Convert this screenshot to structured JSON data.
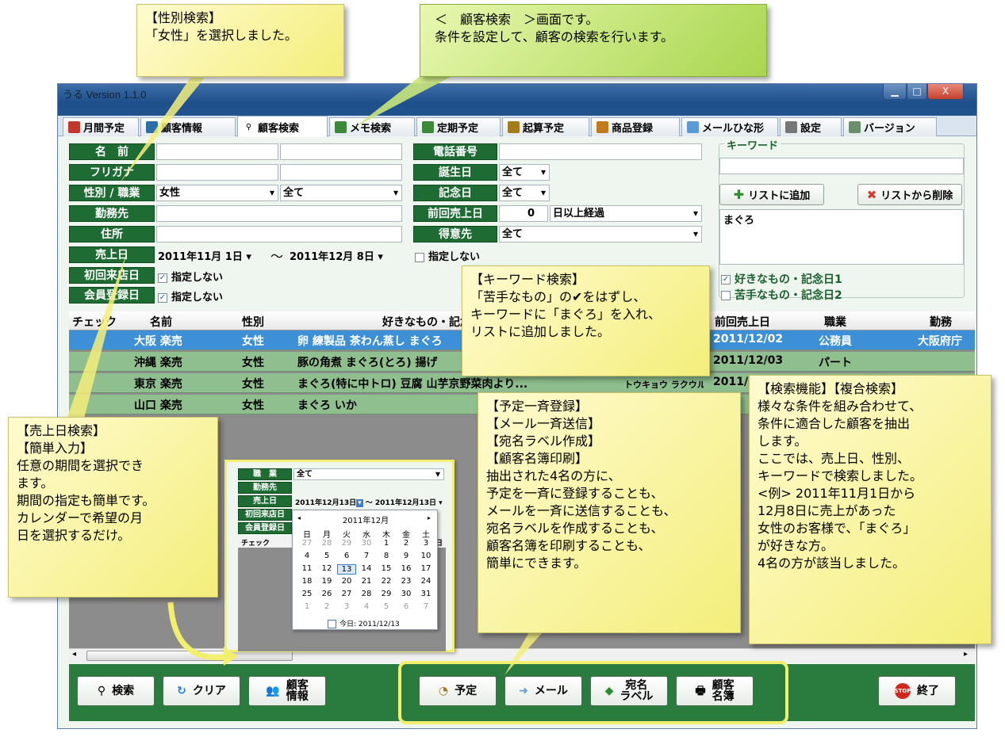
{
  "window": {
    "title": "うる Version 1.1.0",
    "min": "▁",
    "max": "□",
    "close": "X"
  },
  "tabs": [
    {
      "label": "月間予定",
      "icon": "calendar-icon",
      "color": "#c0392b"
    },
    {
      "label": "顧客情報",
      "icon": "people-icon",
      "color": "#2c6fa6"
    },
    {
      "label": "顧客検索",
      "icon": "search-icon",
      "color": "#ffffff"
    },
    {
      "label": "メモ検索",
      "icon": "memo-icon",
      "color": "#3a8a3a"
    },
    {
      "label": "定期予定",
      "icon": "clock-icon",
      "color": "#3a8a3a"
    },
    {
      "label": "起算予定",
      "icon": "timer-icon",
      "color": "#a57c1c"
    },
    {
      "label": "商品登録",
      "icon": "gift-icon",
      "color": "#c07a1c"
    },
    {
      "label": "メールひな形",
      "icon": "mail-icon",
      "color": "#5c9ad6"
    },
    {
      "label": "設定",
      "icon": "tools-icon",
      "color": "#777777"
    },
    {
      "label": "バージョン",
      "icon": "info-icon",
      "color": "#6b8f6b"
    }
  ],
  "form": {
    "name_label": "名　前",
    "furigana_label": "フリガナ",
    "gender_label": "性別 / 職業",
    "gender_value": "女性",
    "job_value": "全て",
    "workplace_label": "勤務先",
    "address_label": "住所",
    "sale_label": "売上日",
    "sale_from": "2011年11月 1日",
    "sale_to": "2011年12月 8日",
    "tilde": "～",
    "first_visit_label": "初回来店日",
    "member_label": "会員登録日",
    "not_specified": "指定しない",
    "check_mark": "✓",
    "phone_label": "電話番号",
    "birthday_label": "誕生日",
    "birthday_value": "全て",
    "anniv_label": "記念日",
    "anniv_value": "全て",
    "last_sale_label": "前回売上日",
    "last_sale_num": "0",
    "last_sale_value": "日以上経過",
    "good_label": "得意先",
    "good_value": "全て"
  },
  "keyword": {
    "legend": "キーワード",
    "add_button": "リストに追加",
    "remove_button": "リストから削除",
    "list_item": "まぐろ",
    "check_like": "好きなもの・記念日1",
    "check_dislike": "苦手なもの・記念日2"
  },
  "grid": {
    "headers": [
      "チェック",
      "名前",
      "性別",
      "好きなもの・記念日1",
      "前回売上日",
      "職業",
      "勤務"
    ],
    "rows": [
      {
        "name": "大阪 楽売",
        "gender": "女性",
        "likes": "卵 練製品 茶わん蒸し まぐろ",
        "kana": "",
        "date": "2011/12/02",
        "job": "公務員",
        "work": "大阪府庁"
      },
      {
        "name": "沖縄 楽売",
        "gender": "女性",
        "likes": "豚の角煮 まぐろ(とろ) 揚げ",
        "kana": "",
        "date": "2011/12/03",
        "job": "パート",
        "work": ""
      },
      {
        "name": "東京 楽売",
        "gender": "女性",
        "likes": "まぐろ(特に中トロ) 豆腐 山芋京野菜肉より...",
        "kana": "トウキョウ ラクウル",
        "date": "2011/1",
        "job": "",
        "work": ""
      },
      {
        "name": "山口 楽売",
        "gender": "女性",
        "likes": "まぐろ いか",
        "kana": "",
        "date": "",
        "job": "",
        "work": ""
      }
    ]
  },
  "bottom": {
    "search": "検索",
    "clear": "クリア",
    "customer1": "顧客",
    "customer2": "情報",
    "schedule": "予定",
    "mail": "メール",
    "label1": "宛名",
    "label2": "ラベル",
    "list1": "顧客",
    "list2": "名簿",
    "exit": "終了",
    "stop": "STOP"
  },
  "inset": {
    "job_label": "職　業",
    "job_value": "全て",
    "work_label": "勤務先",
    "sale_label": "売上日",
    "from": "2011年12月13日",
    "to": "2011年12月13日",
    "first_label": "初回来店日",
    "member_label": "会員登録日",
    "check_label": "チェック",
    "sale_suffix": "上日",
    "cal_title": "2011年12月",
    "weekdays": [
      "日",
      "月",
      "火",
      "水",
      "木",
      "金",
      "土"
    ],
    "days": [
      [
        "27",
        "28",
        "29",
        "30",
        "1",
        "2",
        "3"
      ],
      [
        "4",
        "5",
        "6",
        "7",
        "8",
        "9",
        "10"
      ],
      [
        "11",
        "12",
        "13",
        "14",
        "15",
        "16",
        "17"
      ],
      [
        "18",
        "19",
        "20",
        "21",
        "22",
        "23",
        "24"
      ],
      [
        "25",
        "26",
        "27",
        "28",
        "29",
        "30",
        "31"
      ],
      [
        "1",
        "2",
        "3",
        "4",
        "5",
        "6",
        "7"
      ]
    ],
    "today": "今日: 2011/12/13"
  },
  "notes": {
    "gender": [
      "【性別検索】",
      "「女性」を選択しました。"
    ],
    "screen": [
      "＜　顧客検索　＞画面です。",
      "条件を設定して、顧客の検索を行います。"
    ],
    "keyword": [
      "【キーワード検索】",
      "「苦手なもの」の✔をはずし、",
      "キーワードに「まぐろ」を入れ、",
      "リストに追加しました。"
    ],
    "sale": [
      "【売上日検索】",
      "【簡単入力】",
      "任意の期間を選択でき",
      "ます。",
      "期間の指定も簡単です。",
      "カレンダーで希望の月",
      "日を選択するだけ。"
    ],
    "bulk": [
      "【予定一斉登録】",
      "【メール一斉送信】",
      "【宛名ラベル作成】",
      "【顧客名簿印刷】",
      "抽出された4名の方に、",
      "予定を一斉に登録することも、",
      "メールを一斉に送信することも、",
      "宛名ラベルを作成することも、",
      "顧客名簿を印刷することも、",
      "簡単にできます。"
    ],
    "feature": [
      "【検索機能】【複合検索】",
      "様々な条件を組み合わせて、",
      "条件に適合した顧客を抽出",
      "します。",
      "ここでは、売上日、性別、",
      "キーワードで検索しました。",
      "<例> 2011年11月1日から",
      "12月8日に売上があった",
      "女性のお客様で、「まぐろ」",
      "が好きな方。",
      "4名の方が該当しました。"
    ]
  },
  "colors": {
    "label_green": "#1e6b33",
    "row_selected": "#3d8fd6",
    "row_normal": "#8fbe8f",
    "note_yellow": "#f4ee7a",
    "note_green": "#a9d64f"
  }
}
